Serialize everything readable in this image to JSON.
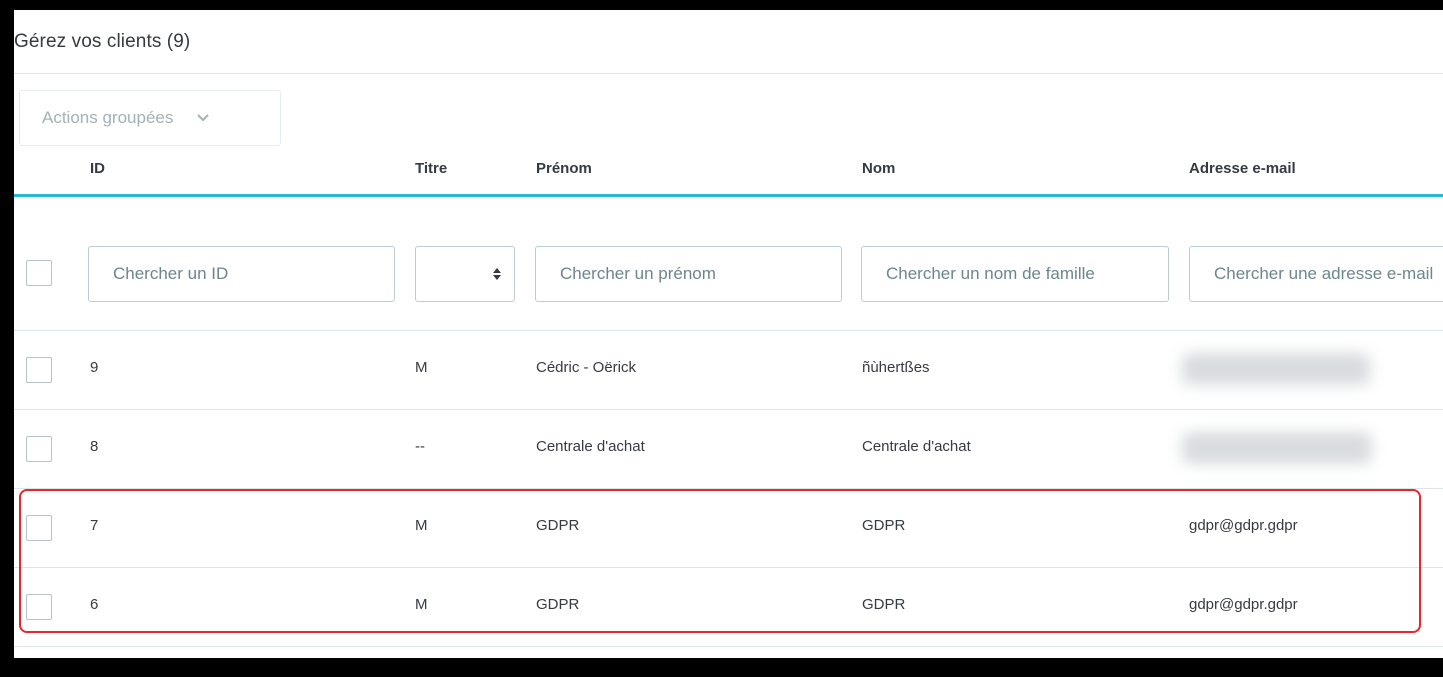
{
  "header": {
    "title": "Gérez vos clients (9)"
  },
  "bulk_actions": {
    "label": "Actions groupées"
  },
  "columns": {
    "id": "ID",
    "title": "Titre",
    "first_name": "Prénom",
    "last_name": "Nom",
    "email": "Adresse e-mail"
  },
  "filters": {
    "id_placeholder": "Chercher un ID",
    "title_value": "",
    "first_name_placeholder": "Chercher un prénom",
    "last_name_placeholder": "Chercher un nom de famille",
    "email_placeholder": "Chercher une adresse e-mail"
  },
  "rows": [
    {
      "id": "9",
      "title": "M",
      "first_name": "Cédric - Oërick",
      "last_name": "ñùhertßes",
      "email": ""
    },
    {
      "id": "8",
      "title": "--",
      "first_name": "Centrale d'achat",
      "last_name": "Centrale d'achat",
      "email": ""
    },
    {
      "id": "7",
      "title": "M",
      "first_name": "GDPR",
      "last_name": "GDPR",
      "email": "gdpr@gdpr.gdpr"
    },
    {
      "id": "6",
      "title": "M",
      "first_name": "GDPR",
      "last_name": "GDPR",
      "email": "gdpr@gdpr.gdpr"
    }
  ],
  "colors": {
    "accent": "#25b9d7",
    "highlight": "#e8262b",
    "text": "#363a41",
    "muted": "#6c868e"
  },
  "icons": {
    "bulk_caret": "chevron-down-icon",
    "select_sort": "sort-icon"
  }
}
